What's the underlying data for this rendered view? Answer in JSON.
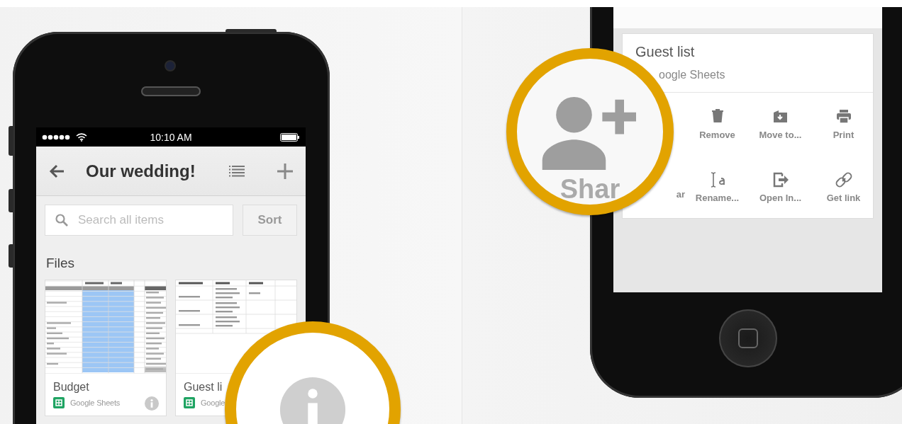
{
  "left_phone": {
    "status_bar": {
      "time": "10:10 AM"
    },
    "app_bar": {
      "title": "Our wedding!"
    },
    "search": {
      "placeholder": "Search all items"
    },
    "sort_button": "Sort",
    "section_title": "Files",
    "files": [
      {
        "kind": "budget",
        "title": "Budget",
        "app": "Google Sheets"
      },
      {
        "kind": "guests",
        "title": "Guest li",
        "app": "Google"
      }
    ]
  },
  "right_phone": {
    "detail_card": {
      "title": "Guest list",
      "app": "oogle Sheets",
      "actions": [
        {
          "kind": "remove",
          "label": "Remove"
        },
        {
          "kind": "move",
          "label": "Move to..."
        },
        {
          "kind": "print",
          "label": "Print"
        },
        {
          "kind": "partial",
          "label": "ar"
        },
        {
          "kind": "rename",
          "label": "Rename..."
        },
        {
          "kind": "open",
          "label": "Open In..."
        },
        {
          "kind": "link",
          "label": "Get link"
        }
      ]
    }
  },
  "magnifiers": [
    {
      "kind": "share",
      "label": "Shar"
    },
    {
      "kind": "info"
    }
  ]
}
